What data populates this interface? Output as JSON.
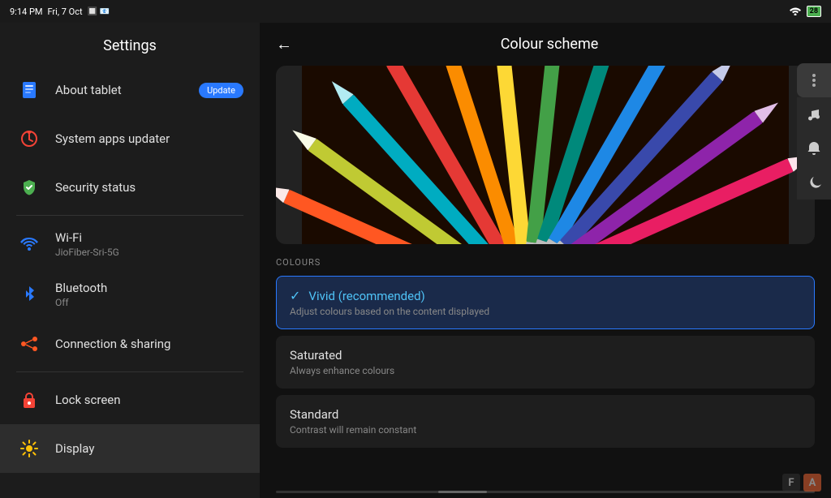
{
  "statusBar": {
    "time": "9:14 PM",
    "date": "Fri, 7 Oct",
    "battery": "28"
  },
  "sidebar": {
    "title": "Settings",
    "items": [
      {
        "id": "about-tablet",
        "label": "About tablet",
        "subtitle": "",
        "badge": "Update",
        "iconColor": "#2979ff",
        "iconShape": "square"
      },
      {
        "id": "system-apps",
        "label": "System apps updater",
        "subtitle": "",
        "badge": "",
        "iconColor": "#f44336",
        "iconShape": "arrow-up"
      },
      {
        "id": "security-status",
        "label": "Security status",
        "subtitle": "",
        "badge": "",
        "iconColor": "#4caf50",
        "iconShape": "shield"
      },
      {
        "id": "wifi",
        "label": "Wi-Fi",
        "subtitle": "JioFiber-Sri-5G",
        "badge": "",
        "iconColor": "#2979ff",
        "iconShape": "wifi"
      },
      {
        "id": "bluetooth",
        "label": "Bluetooth",
        "subtitle": "Off",
        "badge": "",
        "iconColor": "#2979ff",
        "iconShape": "bluetooth"
      },
      {
        "id": "connection-sharing",
        "label": "Connection & sharing",
        "subtitle": "",
        "badge": "",
        "iconColor": "#ff5722",
        "iconShape": "share"
      },
      {
        "id": "lock-screen",
        "label": "Lock screen",
        "subtitle": "",
        "badge": "",
        "iconColor": "#f44336",
        "iconShape": "lock"
      },
      {
        "id": "display",
        "label": "Display",
        "subtitle": "",
        "badge": "",
        "iconColor": "#FFC107",
        "iconShape": "sun",
        "active": true
      }
    ]
  },
  "content": {
    "title": "Colour scheme",
    "coloursSectionLabel": "COLOURS",
    "options": [
      {
        "id": "vivid",
        "label": "Vivid (recommended)",
        "subtitle": "Adjust colours based on the content displayed",
        "selected": true
      },
      {
        "id": "saturated",
        "label": "Saturated",
        "subtitle": "Always enhance colours",
        "selected": false
      },
      {
        "id": "standard",
        "label": "Standard",
        "subtitle": "Contrast will remain constant",
        "selected": false
      }
    ]
  },
  "floatingButtons": {
    "music": "♪",
    "notification": "🔔",
    "moon": "🌙"
  },
  "watermark": {
    "f": "F",
    "a": "A"
  }
}
